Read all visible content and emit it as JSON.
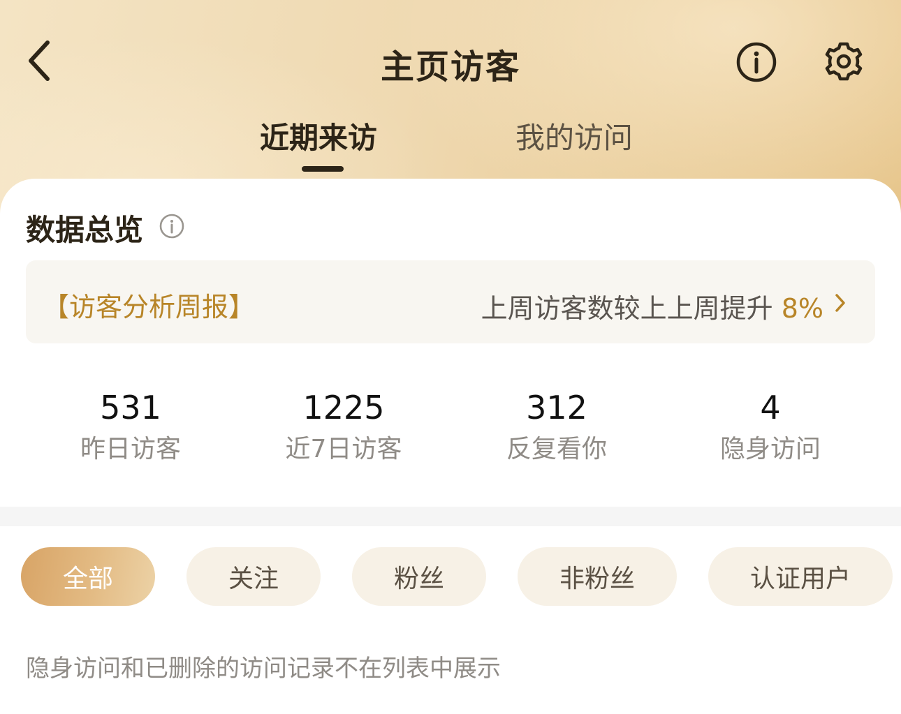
{
  "header": {
    "title": "主页访客",
    "back_icon": "chevron-left-icon",
    "info_icon": "info-circle-icon",
    "settings_icon": "gear-icon"
  },
  "tabs": [
    {
      "label": "近期来访",
      "active": true
    },
    {
      "label": "我的访问",
      "active": false
    }
  ],
  "overview": {
    "title": "数据总览",
    "info_icon": "info-circle-icon",
    "report": {
      "title": "【访客分析周报】",
      "summary": "上周访客数较上上周提升",
      "percent": "8%"
    },
    "stats": [
      {
        "value": "531",
        "label": "昨日访客"
      },
      {
        "value": "1225",
        "label": "近7日访客"
      },
      {
        "value": "312",
        "label": "反复看你"
      },
      {
        "value": "4",
        "label": "隐身访问"
      }
    ]
  },
  "filters": [
    {
      "label": "全部",
      "active": true
    },
    {
      "label": "关注",
      "active": false
    },
    {
      "label": "粉丝",
      "active": false
    },
    {
      "label": "非粉丝",
      "active": false
    },
    {
      "label": "认证用户",
      "active": false
    }
  ],
  "footnote": "隐身访问和已删除的访问记录不在列表中展示",
  "colors": {
    "accent_gold": "#b88528",
    "title_dark": "#2c2417",
    "muted_gray": "#8f8b86",
    "chip_bg": "#f7f1e6"
  }
}
